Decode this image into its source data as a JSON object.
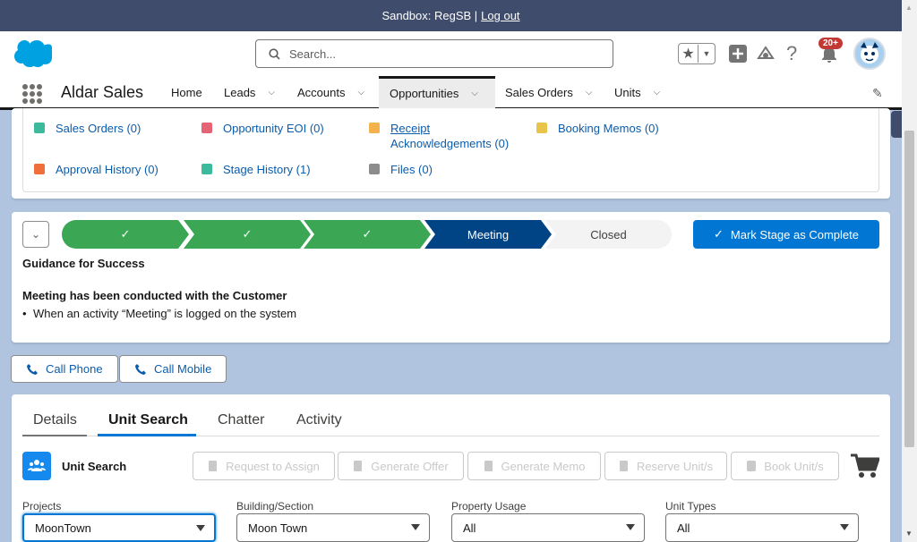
{
  "sandbox": {
    "text": "Sandbox: RegSB |",
    "logout": "Log out"
  },
  "header": {
    "search_placeholder": "Search...",
    "notification_count": "20+"
  },
  "app": {
    "name": "Aldar Sales"
  },
  "nav": {
    "items": [
      {
        "label": "Home"
      },
      {
        "label": "Leads"
      },
      {
        "label": "Accounts"
      },
      {
        "label": "Opportunities"
      },
      {
        "label": "Sales Orders"
      },
      {
        "label": "Units"
      }
    ]
  },
  "related": {
    "links": [
      {
        "label": "Sales Orders (0)",
        "icon": "sales-orders-icon",
        "color": "#3bba9c"
      },
      {
        "label": "Opportunity EOI (0)",
        "icon": "opportunity-eoi-icon",
        "color": "#e56372"
      },
      {
        "label": "Receipt",
        "label2": "Acknowledgements (0)",
        "icon": "receipt-icon",
        "color": "#f4b24d"
      },
      {
        "label": "Booking Memos (0)",
        "icon": "booking-memos-icon",
        "color": "#e8c44b"
      },
      {
        "label": "Approval History (0)",
        "icon": "approval-history-icon",
        "color": "#ef6e3a"
      },
      {
        "label": "Stage History (1)",
        "icon": "stage-history-icon",
        "color": "#3bba9c"
      },
      {
        "label": "Files (0)",
        "icon": "files-icon",
        "color": "#8c8c8c"
      }
    ]
  },
  "path": {
    "stages": [
      {
        "label": "",
        "state": "complete"
      },
      {
        "label": "",
        "state": "complete"
      },
      {
        "label": "",
        "state": "complete"
      },
      {
        "label": "Meeting",
        "state": "current"
      },
      {
        "label": "Closed",
        "state": "incomplete"
      }
    ],
    "complete_button": "Mark Stage as Complete",
    "guidance_title": "Guidance for Success",
    "guidance_heading": "Meeting has been conducted with the Customer",
    "guidance_bullet": "When an activity “Meeting” is logged on the system",
    "colors": {
      "complete": "#3ba755",
      "current": "#014486",
      "incomplete": "#f3f3f3",
      "brand": "#0176d3"
    }
  },
  "actions": {
    "call_phone": "Call Phone",
    "call_mobile": "Call Mobile"
  },
  "tabs": [
    {
      "label": "Details"
    },
    {
      "label": "Unit Search"
    },
    {
      "label": "Chatter"
    },
    {
      "label": "Activity"
    }
  ],
  "unit_search": {
    "title": "Unit Search",
    "buttons": [
      {
        "label": "Request to Assign"
      },
      {
        "label": "Generate Offer"
      },
      {
        "label": "Generate Memo"
      },
      {
        "label": "Reserve Unit/s"
      },
      {
        "label": "Book Unit/s"
      }
    ],
    "filters": [
      {
        "label": "Projects",
        "value": "MoonTown"
      },
      {
        "label": "Building/Section",
        "value": "Moon Town"
      },
      {
        "label": "Property Usage",
        "value": "All"
      },
      {
        "label": "Unit Types",
        "value": "All"
      }
    ]
  }
}
